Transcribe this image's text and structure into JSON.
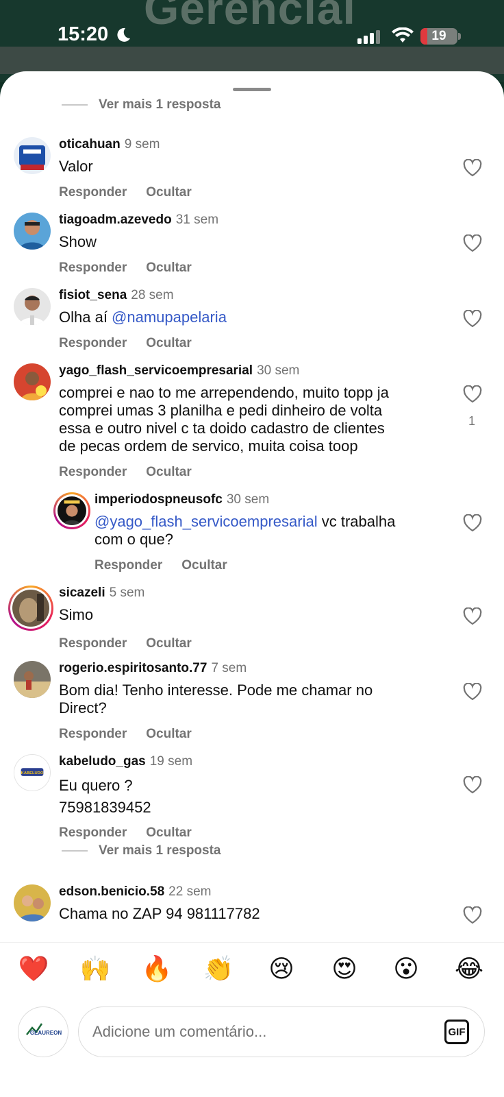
{
  "status_bar": {
    "time": "15:20",
    "battery": "19",
    "battery_level": 0.19
  },
  "background": {
    "brand_text": "Gerencial"
  },
  "comments": {
    "see_more_top": "Ver mais 1 resposta",
    "see_more_mid": "Ver mais 1 resposta",
    "reply_label": "Responder",
    "hide_label": "Ocultar",
    "items": [
      {
        "username": "oticahuan",
        "time": "9 sem",
        "text": "Valor"
      },
      {
        "username": "tiagoadm.azevedo",
        "time": "31 sem",
        "text": "Show"
      },
      {
        "username": "fisiot_sena",
        "time": "28 sem",
        "text_prefix": "Olha aí ",
        "mention": "@namupapelaria"
      },
      {
        "username": "yago_flash_servicoempresarial",
        "time": "30 sem",
        "lines": [
          "comprei e nao to me arrependendo, muito topp ja",
          "comprei umas 3 planilha e pedi dinheiro de volta",
          "essa e outro nivel c ta doido cadastro de clientes",
          "de pecas ordem de servico, muita coisa toop"
        ],
        "likes": "1"
      },
      {
        "username": "imperiodospneusofc",
        "time": "30 sem",
        "mention": "@yago_flash_servicoempresarial",
        "text_suffix": " vc trabalha",
        "line2": "com o que?"
      },
      {
        "username": "sicazeli",
        "time": "5 sem",
        "text": "Simo"
      },
      {
        "username": "rogerio.espiritosanto.77",
        "time": "7 sem",
        "lines": [
          "Bom dia! Tenho interesse. Pode me chamar no",
          "Direct?"
        ]
      },
      {
        "username": "kabeludo_gas",
        "time": "19 sem",
        "lines": [
          "Eu quero ?",
          "75981839452"
        ],
        "avatar_text": "KABELUDO"
      },
      {
        "username": "edson.benicio.58",
        "time": "22 sem",
        "text": "Chama no ZAP 94 981117782"
      }
    ]
  },
  "reactions": [
    "❤️",
    "🙌",
    "🔥",
    "👏",
    "😢",
    "😍",
    "😮",
    "😂"
  ],
  "composer": {
    "placeholder": "Adicione um comentário...",
    "gif_label": "GIF",
    "avatar_text": "GEAUREON"
  }
}
